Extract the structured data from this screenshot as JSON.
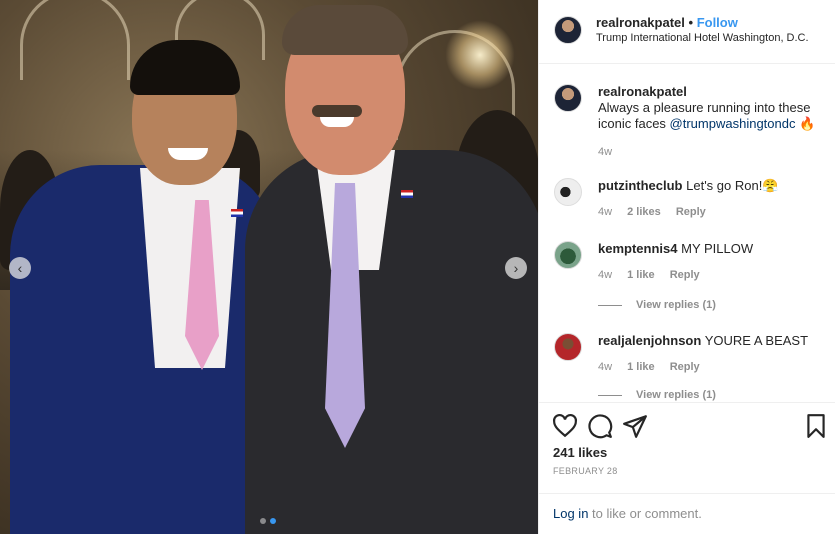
{
  "post": {
    "username": "realronakpatel",
    "separator": "•",
    "follow_label": "Follow",
    "location": "Trump International Hotel Washington, D.C."
  },
  "caption": {
    "username": "realronakpatel",
    "text": "Always a pleasure running into these iconic faces ",
    "mention": "@trumpwashingtondc",
    "emoji": "🔥",
    "time": "4w"
  },
  "comments": [
    {
      "username": "putzintheclub",
      "text": "Let's go Ron!😤",
      "time": "4w",
      "likes": "2 likes",
      "reply": "Reply",
      "avatar": "eagle-avatar"
    },
    {
      "username": "kemptennis4",
      "text": "MY PILLOW",
      "time": "4w",
      "likes": "1 like",
      "reply": "Reply",
      "view_replies": "View replies (1)",
      "avatar": "tennis-avatar"
    },
    {
      "username": "realjalenjohnson",
      "text": "YOURE A BEAST",
      "time": "4w",
      "likes": "1 like",
      "reply": "Reply",
      "view_replies": "View replies (1)",
      "avatar": "jalen-avatar"
    }
  ],
  "actions": {
    "likes": "241 likes",
    "date": "FEBRUARY 28",
    "login_link": "Log in",
    "login_suffix": " to like or comment."
  },
  "carousel": {
    "prev_icon": "chevron-left-icon",
    "next_icon": "chevron-right-icon",
    "current_index": 2,
    "total": 2
  },
  "colors": {
    "accent": "#3897f0",
    "mention": "#003569",
    "muted": "#8e8e8e",
    "border": "#efefef"
  }
}
